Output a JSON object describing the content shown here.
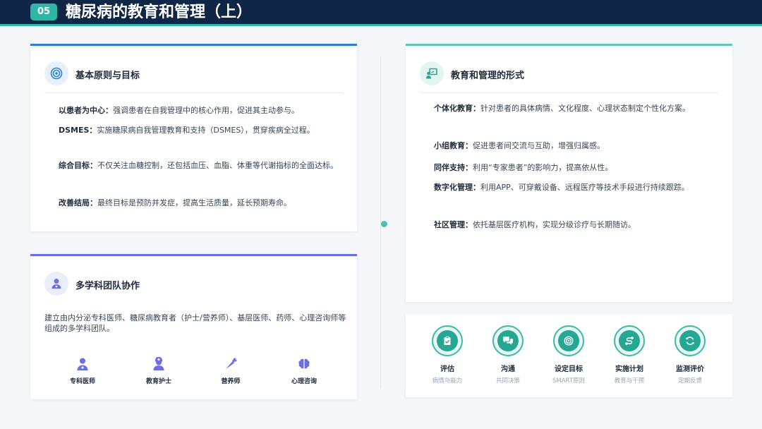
{
  "header": {
    "badge": "05",
    "title": "糖尿病的教育和管理（上）"
  },
  "principles": {
    "title": "基本原则与目标",
    "items": [
      {
        "label": "以患者为中心：",
        "text": "强调患者在自我管理中的核心作用，促进其主动参与。"
      },
      {
        "label": "DSMES：",
        "text": "实施糖尿病自我管理教育和支持（DSMES），贯穿疾病全过程。"
      },
      {
        "label": "综合目标：",
        "text": "不仅关注血糖控制，还包括血压、血脂、体重等代谢指标的全面达标。"
      },
      {
        "label": "改善结局：",
        "text": "最终目标是预防并发症，提高生活质量，延长预期寿命。"
      }
    ]
  },
  "team": {
    "title": "多学科团队协作",
    "description": "建立由内分泌专科医师、糖尿病教育者（护士/营养师）、基层医师、药师、心理咨询师等组成的多学科团队。",
    "roles": [
      {
        "label": "专科医师",
        "icon": "doctor-icon"
      },
      {
        "label": "教育护士",
        "icon": "nurse-icon"
      },
      {
        "label": "营养师",
        "icon": "carrot-icon"
      },
      {
        "label": "心理咨询",
        "icon": "brain-icon"
      }
    ]
  },
  "forms": {
    "title": "教育和管理的形式",
    "items": [
      {
        "label": "个体化教育：",
        "text": "针对患者的具体病情、文化程度、心理状态制定个性化方案。"
      },
      {
        "label": "小组教育：",
        "text": "促进患者间交流与互助，增强归属感。"
      },
      {
        "label": "同伴支持：",
        "text": "利用“专家患者”的影响力，提高依从性。"
      },
      {
        "label": "数字化管理：",
        "text": "利用APP、可穿戴设备、远程医疗等技术手段进行持续跟踪。"
      },
      {
        "label": "社区管理：",
        "text": "依托基层医疗机构，实现分级诊疗与长期随访。"
      }
    ]
  },
  "process": {
    "steps": [
      {
        "title": "评估",
        "subtitle": "病情与能力",
        "icon": "clipboard-icon"
      },
      {
        "title": "沟通",
        "subtitle": "共同决策",
        "icon": "chat-icon"
      },
      {
        "title": "设定目标",
        "subtitle": "SMART原则",
        "icon": "target-icon"
      },
      {
        "title": "实施计划",
        "subtitle": "教育与干预",
        "icon": "route-icon"
      },
      {
        "title": "监测评价",
        "subtitle": "定期反馈",
        "icon": "refresh-icon"
      }
    ]
  },
  "colors": {
    "navy": "#0f2647",
    "teal": "#2fb7a4",
    "blue": "#2b7fd4",
    "indigo": "#6b6fe0"
  }
}
